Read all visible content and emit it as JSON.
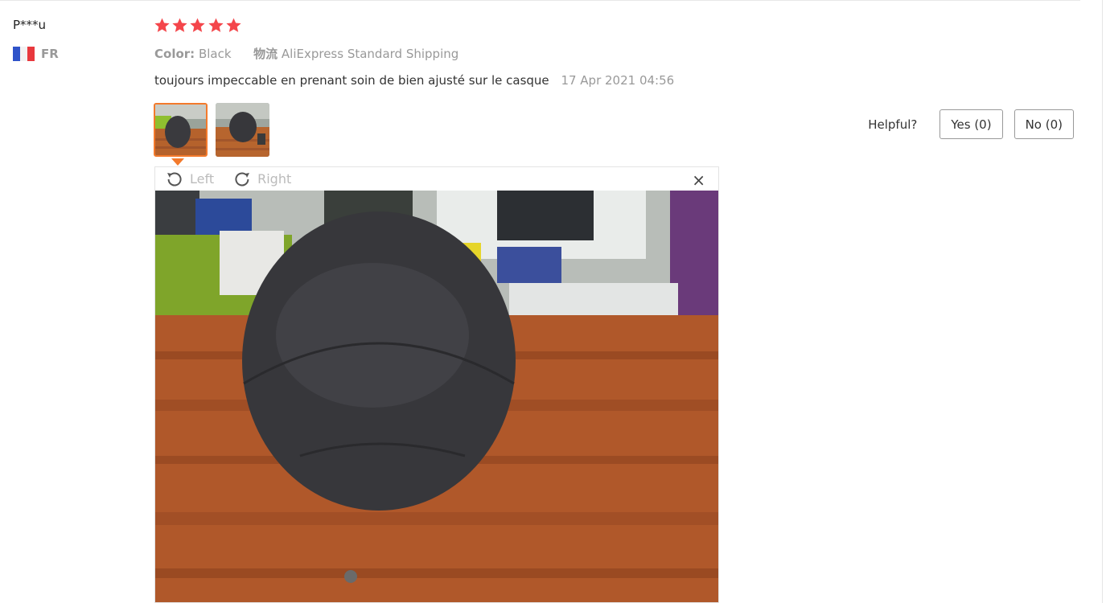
{
  "reviewer": {
    "name": "P***u",
    "country_code": "FR",
    "flag_colors": [
      "#2f53c9",
      "#f2f2f2",
      "#e8383d"
    ]
  },
  "rating": {
    "stars": 5,
    "max": 5,
    "star_color": "#f4464b"
  },
  "meta": {
    "color_label": "Color:",
    "color_value": "Black",
    "logistics_label": "物流",
    "logistics_value": "AliExpress Standard Shipping"
  },
  "review": {
    "text": "toujours impeccable en prenant soin de bien ajusté sur le casque",
    "date": "17 Apr 2021 04:56"
  },
  "thumbnails": [
    {
      "name": "photo-1",
      "selected": true
    },
    {
      "name": "photo-2",
      "selected": false
    }
  ],
  "helpful": {
    "label": "Helpful?",
    "yes_label": "Yes (0)",
    "no_label": "No (0)"
  },
  "viewer": {
    "rotate_left_label": "Left",
    "rotate_right_label": "Right",
    "close_glyph": "×"
  },
  "colors": {
    "accent_orange": "#f37a2c",
    "muted_text": "#999999"
  }
}
